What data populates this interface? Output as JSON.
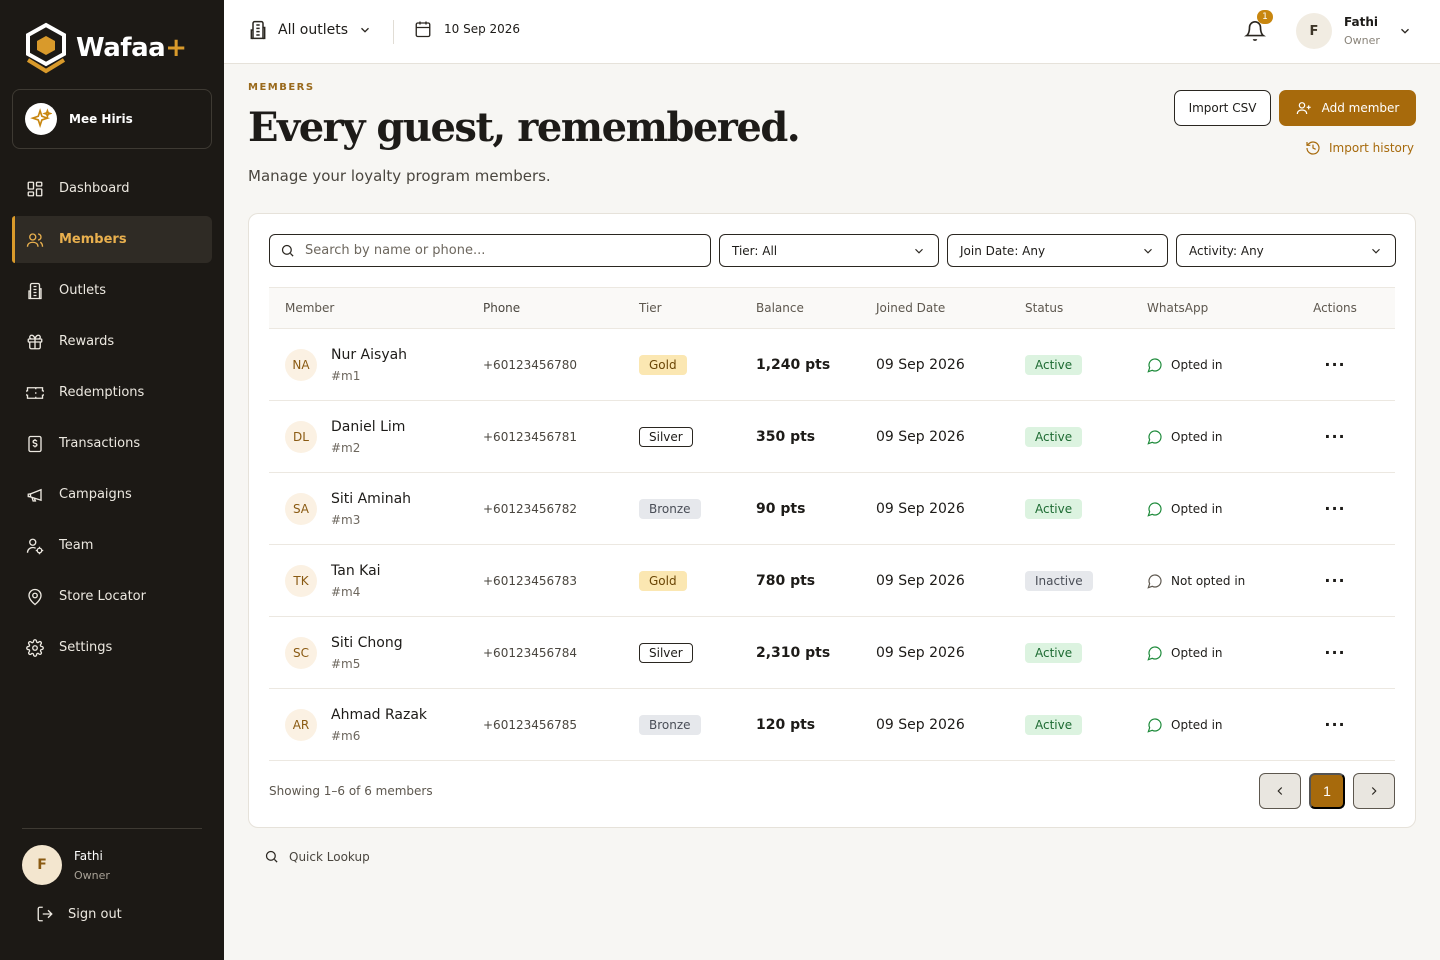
{
  "brand": {
    "name": "Wafaa",
    "plus": "+",
    "accent": "#d99a2b"
  },
  "outlet": {
    "name": "Mee Hiris"
  },
  "nav": [
    {
      "label": "Dashboard",
      "icon": "dashboard-icon",
      "active": false
    },
    {
      "label": "Members",
      "icon": "users-icon",
      "active": true
    },
    {
      "label": "Outlets",
      "icon": "building-icon",
      "active": false
    },
    {
      "label": "Rewards",
      "icon": "gift-icon",
      "active": false
    },
    {
      "label": "Redemptions",
      "icon": "ticket-icon",
      "active": false
    },
    {
      "label": "Transactions",
      "icon": "receipt-icon",
      "active": false
    },
    {
      "label": "Campaigns",
      "icon": "megaphone-icon",
      "active": false
    },
    {
      "label": "Team",
      "icon": "team-icon",
      "active": false
    },
    {
      "label": "Store Locator",
      "icon": "map-pin-icon",
      "active": false
    },
    {
      "label": "Settings",
      "icon": "gear-icon",
      "active": false
    }
  ],
  "sidebar_user": {
    "initial": "F",
    "name": "Fathi",
    "role": "Owner",
    "signout": "Sign out"
  },
  "topbar": {
    "outlet_select": "All outlets",
    "date": "10 Sep 2026",
    "notifications": "1",
    "user": {
      "initial": "F",
      "name": "Fathi",
      "role": "Owner"
    }
  },
  "header": {
    "eyebrow": "MEMBERS",
    "title": "Every guest, remembered.",
    "subtitle": "Manage your loyalty program members.",
    "import_csv": "Import CSV",
    "add_member": "Add member",
    "import_history": "Import history"
  },
  "filters": {
    "search_placeholder": "Search by name or phone...",
    "tier": "Tier: All",
    "join_date": "Join Date: Any",
    "activity": "Activity: Any"
  },
  "table": {
    "columns": [
      "Member",
      "Phone",
      "Tier",
      "Balance",
      "Joined Date",
      "Status",
      "WhatsApp",
      "Actions"
    ],
    "rows": [
      {
        "initials": "NA",
        "name": "Nur Aisyah",
        "id": "#m1",
        "phone": "+60123456780",
        "tier": "Gold",
        "balance": "1,240 pts",
        "joined": "09 Sep 2026",
        "status": "Active",
        "whatsapp": "Opted in"
      },
      {
        "initials": "DL",
        "name": "Daniel Lim",
        "id": "#m2",
        "phone": "+60123456781",
        "tier": "Silver",
        "balance": "350 pts",
        "joined": "09 Sep 2026",
        "status": "Active",
        "whatsapp": "Opted in"
      },
      {
        "initials": "SA",
        "name": "Siti Aminah",
        "id": "#m3",
        "phone": "+60123456782",
        "tier": "Bronze",
        "balance": "90 pts",
        "joined": "09 Sep 2026",
        "status": "Active",
        "whatsapp": "Opted in"
      },
      {
        "initials": "TK",
        "name": "Tan Kai",
        "id": "#m4",
        "phone": "+60123456783",
        "tier": "Gold",
        "balance": "780 pts",
        "joined": "09 Sep 2026",
        "status": "Inactive",
        "whatsapp": "Not opted in"
      },
      {
        "initials": "SC",
        "name": "Siti Chong",
        "id": "#m5",
        "phone": "+60123456784",
        "tier": "Silver",
        "balance": "2,310 pts",
        "joined": "09 Sep 2026",
        "status": "Active",
        "whatsapp": "Opted in"
      },
      {
        "initials": "AR",
        "name": "Ahmad Razak",
        "id": "#m6",
        "phone": "+60123456785",
        "tier": "Bronze",
        "balance": "120 pts",
        "joined": "09 Sep 2026",
        "status": "Active",
        "whatsapp": "Opted in"
      }
    ],
    "actions_label": "···"
  },
  "pagination": {
    "showing": "Showing 1–6 of 6 members",
    "current": "1",
    "prev": "‹",
    "next": "›"
  },
  "quick_lookup": "Quick Lookup"
}
